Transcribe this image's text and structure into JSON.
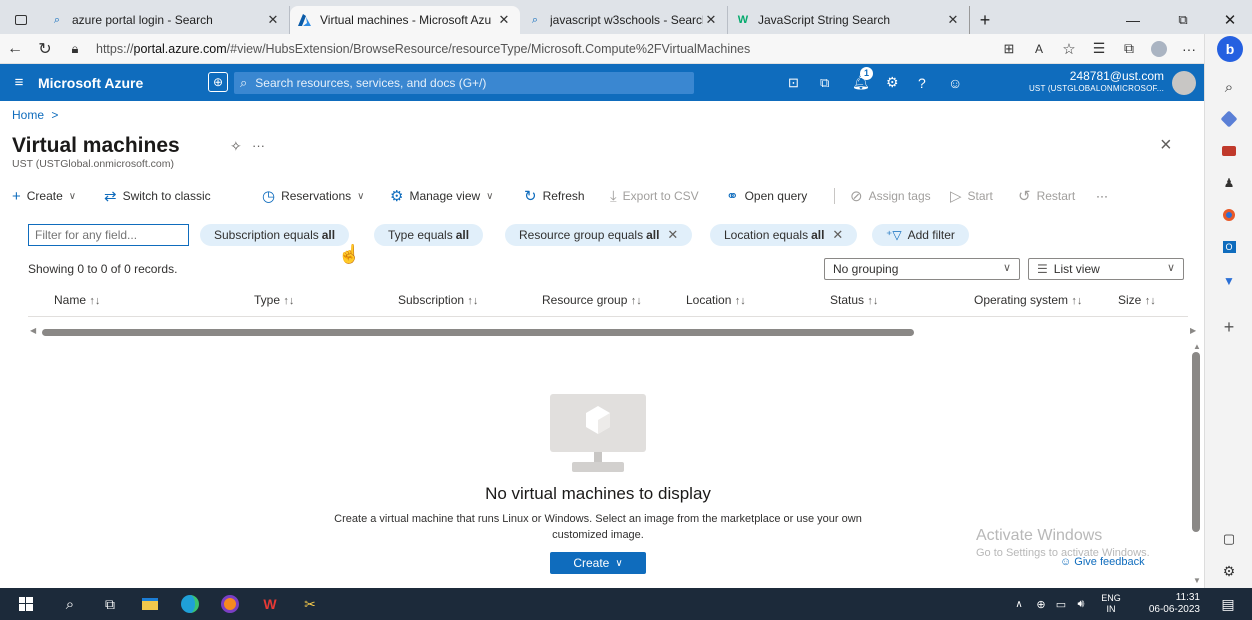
{
  "browser": {
    "tabs": [
      {
        "title": "azure portal login - Search",
        "icon": "search-icon"
      },
      {
        "title": "Virtual machines - Microsoft Azu",
        "icon": "azure-logo-icon"
      },
      {
        "title": "javascript w3schools - Search",
        "icon": "search-icon"
      },
      {
        "title": "JavaScript String Search",
        "icon": "w3schools-icon"
      }
    ],
    "url_prefix": "https://",
    "url_host": "portal.azure.com",
    "url_path": "/#view/HubsExtension/BrowseResource/resourceType/Microsoft.Compute%2FVirtualMachines"
  },
  "azure": {
    "brand": "Microsoft Azure",
    "search_placeholder": "Search resources, services, and docs (G+/)",
    "notification_count": "1",
    "user_email": "248781@ust.com",
    "user_tenant": "UST (USTGLOBALONMICROSOF..."
  },
  "page": {
    "breadcrumb_home": "Home",
    "breadcrumb_sep": ">",
    "title": "Virtual machines",
    "subtitle": "UST (USTGlobal.onmicrosoft.com)",
    "more": "···",
    "close": "×"
  },
  "toolbar": {
    "create": "Create",
    "switch": "Switch to classic",
    "reservations": "Reservations",
    "manage_view": "Manage view",
    "refresh": "Refresh",
    "export": "Export to CSV",
    "open_query": "Open query",
    "assign_tags": "Assign tags",
    "start": "Start",
    "restart": "Restart",
    "more": "···"
  },
  "filters": {
    "placeholder": "Filter for any field...",
    "pills": [
      {
        "label": "Subscription equals",
        "value": "all",
        "removable": false
      },
      {
        "label": "Type equals",
        "value": "all",
        "removable": false
      },
      {
        "label": "Resource group equals",
        "value": "all",
        "removable": true
      },
      {
        "label": "Location equals",
        "value": "all",
        "removable": true
      }
    ],
    "add_filter": "Add filter"
  },
  "records": {
    "showing": "Showing 0 to 0 of 0 records.",
    "grouping": "No grouping",
    "view": "List view"
  },
  "columns": [
    "Name",
    "Type",
    "Subscription",
    "Resource group",
    "Location",
    "Status",
    "Operating system",
    "Size"
  ],
  "empty": {
    "title": "No virtual machines to display",
    "desc_line1": "Create a virtual machine that runs Linux or Windows. Select an image from the marketplace or use your own",
    "desc_line2": "customized image.",
    "button": "Create"
  },
  "watermark": {
    "line1": "Activate Windows",
    "line2": "Go to Settings to activate Windows."
  },
  "feedback": "Give feedback",
  "taskbar": {
    "lang": "ENG",
    "region": "IN",
    "time": "11:31",
    "date": "06-06-2023"
  },
  "colors": {
    "azure_blue": "#0f6cbd",
    "pill_bg": "#e1effa",
    "taskbar": "#1c2a3a"
  }
}
